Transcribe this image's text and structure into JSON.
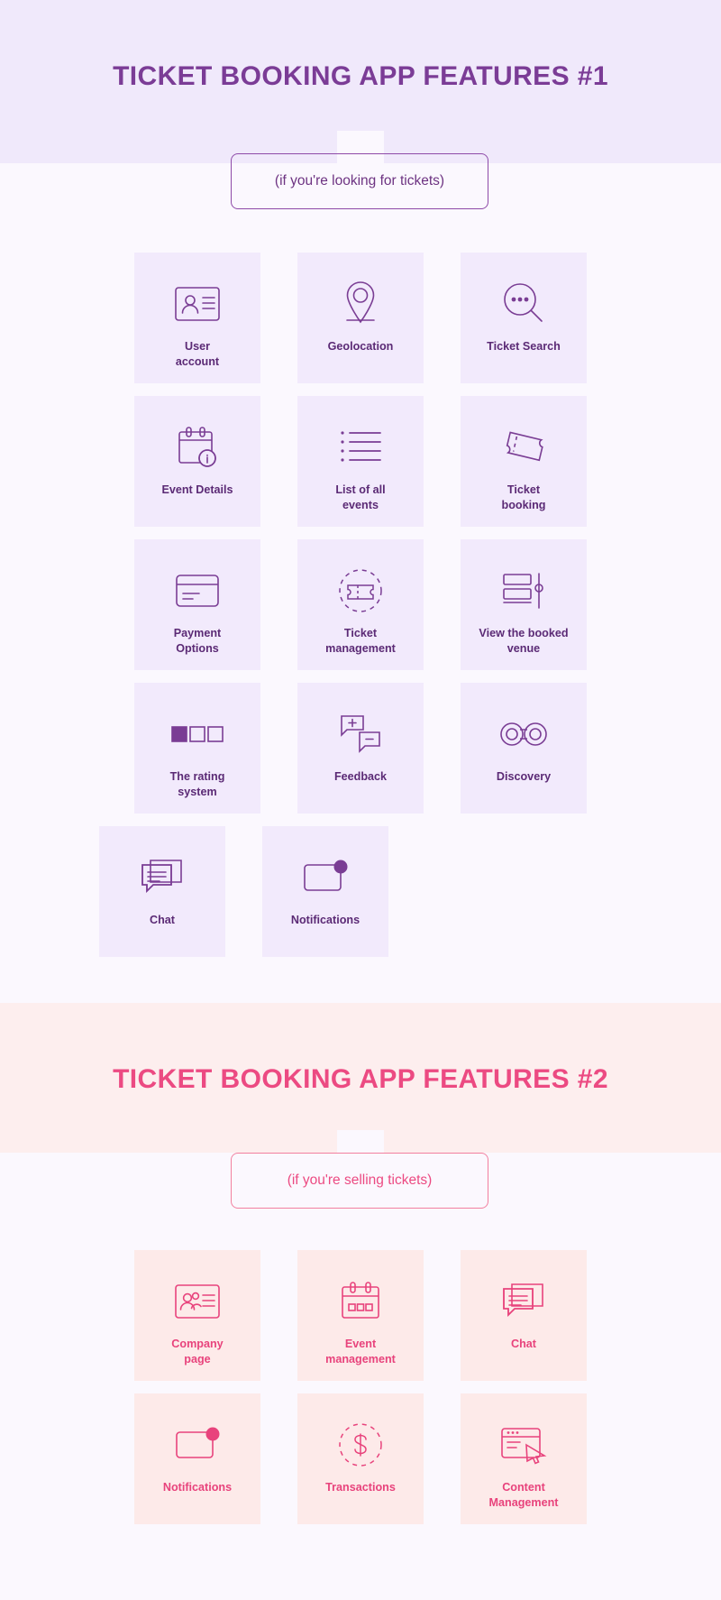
{
  "colors": {
    "purple_band": "#f0e9fb",
    "purple_card": "#f2eafc",
    "purple_text": "#5b2a75",
    "purple_title": "#7b3c96",
    "pink_band": "#fdeeee",
    "pink_card": "#fdeae9",
    "pink_text": "#e8437c",
    "pink_title": "#ec4a82",
    "page_bg": "#fbf8fe"
  },
  "sections": [
    {
      "title": "TICKET BOOKING APP FEATURES #1",
      "subtitle": "(if you're looking for tickets)",
      "rows": [
        [
          {
            "label": "User\naccount",
            "icon": "user-account-icon"
          },
          {
            "label": "Geolocation",
            "icon": "geolocation-pin-icon"
          },
          {
            "label": "Ticket Search",
            "icon": "ticket-search-icon"
          }
        ],
        [
          {
            "label": "Event Details",
            "icon": "event-details-calendar-icon"
          },
          {
            "label": "List of all\nevents",
            "icon": "list-of-events-icon"
          },
          {
            "label": "Ticket\nbooking",
            "icon": "ticket-booking-icon"
          }
        ],
        [
          {
            "label": "Payment\nOptions",
            "icon": "payment-card-icon"
          },
          {
            "label": "Ticket\nmanagement",
            "icon": "ticket-management-icon"
          },
          {
            "label": "View the booked\nvenue",
            "icon": "venue-seats-icon"
          }
        ],
        [
          {
            "label": "The rating\nsystem",
            "icon": "rating-squares-icon"
          },
          {
            "label": "Feedback",
            "icon": "feedback-bubbles-icon"
          },
          {
            "label": "Discovery",
            "icon": "discovery-binoculars-icon"
          }
        ],
        [
          {
            "label": "Chat",
            "icon": "chat-bubbles-icon"
          },
          {
            "label": "Notifications",
            "icon": "notifications-badge-icon"
          }
        ]
      ]
    },
    {
      "title": "TICKET BOOKING APP FEATURES #2",
      "subtitle": "(if you're selling tickets)",
      "rows": [
        [
          {
            "label": "Company\npage",
            "icon": "company-page-icon"
          },
          {
            "label": "Event\nmanagement",
            "icon": "event-management-calendar-icon"
          },
          {
            "label": "Chat",
            "icon": "chat-bubbles-icon"
          }
        ],
        [
          {
            "label": "Notifications",
            "icon": "notifications-badge-icon"
          },
          {
            "label": "Transactions",
            "icon": "transactions-dollar-icon"
          },
          {
            "label": "Content\nManagement",
            "icon": "content-management-icon"
          }
        ]
      ]
    }
  ]
}
